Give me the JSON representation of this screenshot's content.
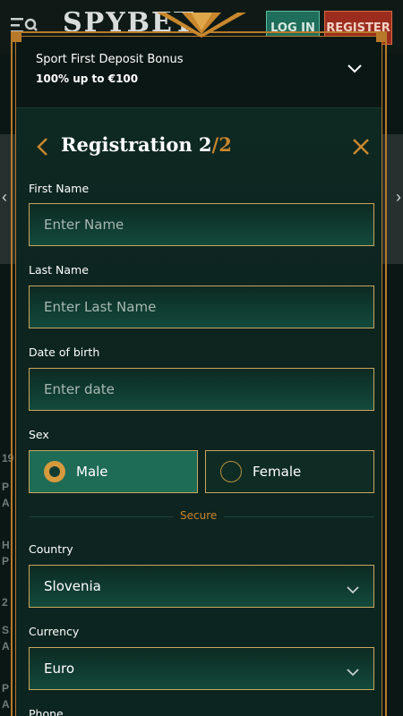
{
  "background": {
    "logo_text": "SPYBET",
    "login_label": "LOG IN",
    "register_label": "REGISTER",
    "side_texts": [
      "19",
      "P",
      "A",
      "H",
      "P",
      "2",
      "S",
      "A",
      "P",
      "A"
    ]
  },
  "bonus": {
    "title": "Sport First Deposit Bonus",
    "subtitle": "100% up to €100"
  },
  "registration": {
    "title": "Registration 2",
    "step_separator": "/",
    "step_total": "2"
  },
  "form": {
    "first_name": {
      "label": "First Name",
      "placeholder": "Enter Name"
    },
    "last_name": {
      "label": "Last Name",
      "placeholder": "Enter Last Name"
    },
    "dob": {
      "label": "Date of birth",
      "placeholder": "Enter date"
    },
    "sex": {
      "label": "Sex",
      "options": [
        "Male",
        "Female"
      ],
      "selected": "Male"
    },
    "secure_label": "Secure",
    "country": {
      "label": "Country",
      "value": "Slovenia"
    },
    "currency": {
      "label": "Currency",
      "value": "Euro"
    },
    "phone": {
      "label": "Phone"
    }
  },
  "colors": {
    "accent_gold": "#c9872d",
    "frame_gold": "#b87a2a",
    "selected_green": "#1e6b56",
    "login_green": "#1f6e5b",
    "register_red": "#9c2d1e"
  }
}
